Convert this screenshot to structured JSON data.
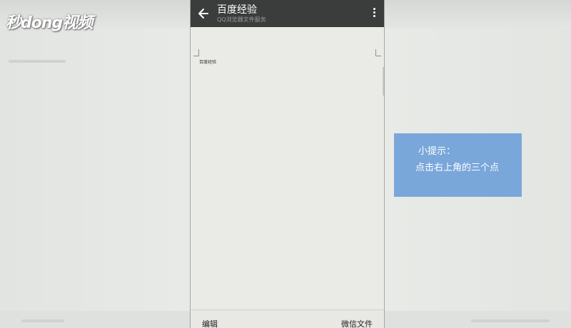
{
  "watermark": {
    "text": "秒dong视频"
  },
  "phone": {
    "header": {
      "title": "百度经验",
      "subtitle": "QQ浏览器文件服务",
      "back_icon": "arrow-left-icon",
      "more_icon": "more-vert-icon"
    },
    "document": {
      "text": "百度经验"
    },
    "bottom_bar": {
      "edit_label": "编辑",
      "wechat_file_label": "微信文件"
    }
  },
  "tip": {
    "title": "小提示：",
    "body": "点击右上角的三个点"
  },
  "colors": {
    "header_bg": "#3b3d3c",
    "tip_bg": "#7aa7da",
    "background": "#e9ebe8"
  }
}
